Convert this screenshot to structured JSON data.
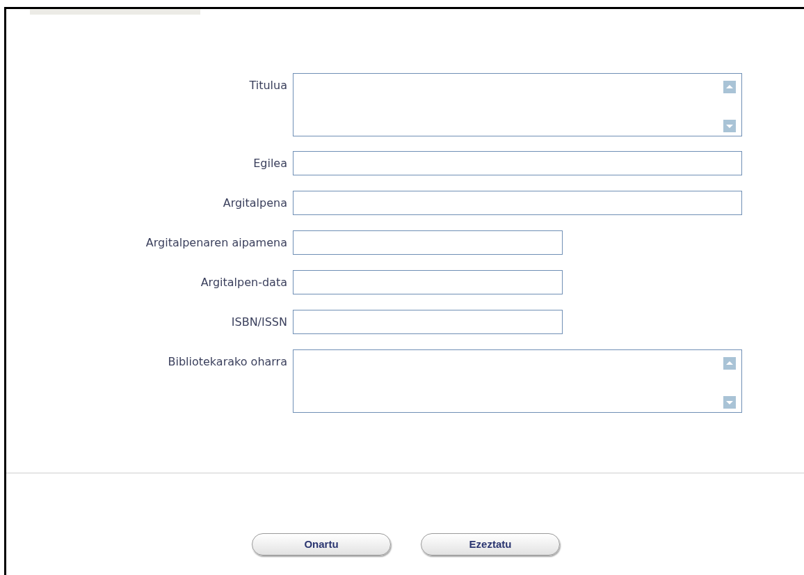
{
  "fields": [
    {
      "label": "Titulua",
      "kind": "textarea"
    },
    {
      "label": "Egilea",
      "kind": "input"
    },
    {
      "label": "Argitalpena",
      "kind": "input"
    },
    {
      "label": "Argitalpenaren aipamena",
      "kind": "short"
    },
    {
      "label": "Argitalpen-data",
      "kind": "short"
    },
    {
      "label": "ISBN/ISSN",
      "kind": "short"
    },
    {
      "label": "Bibliotekarako oharra",
      "kind": "textarea"
    }
  ],
  "buttons": [
    "Onartu",
    "Ezeztatu"
  ]
}
